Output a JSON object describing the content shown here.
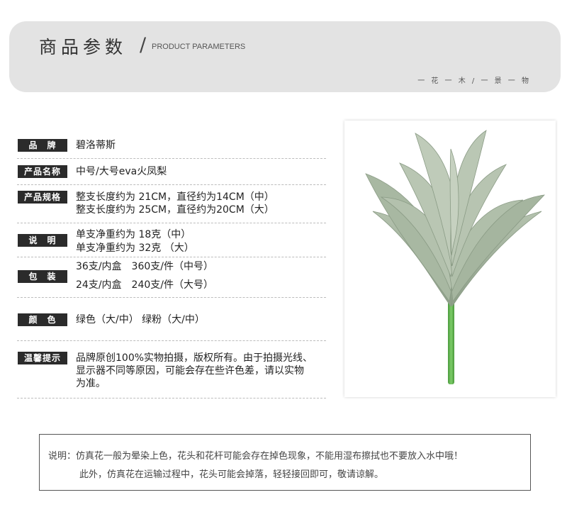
{
  "header": {
    "title": "商品参数",
    "slash": "/",
    "subtitle": "PRODUCT PARAMETERS",
    "tagline": "一 花 一 木 / 一 景 一 物"
  },
  "params": [
    {
      "label": "品　牌",
      "lines": [
        "碧洛蒂斯"
      ]
    },
    {
      "label": "产品名称",
      "lines": [
        "中号/大号eva火凤梨"
      ]
    },
    {
      "label": "产品规格",
      "lines": [
        "整支长度约为 21CM，直径约为14CM（中）",
        "整支长度约为 25CM，直径约为20CM（大）"
      ]
    },
    {
      "label": "说　明",
      "lines": [
        "单支净重约为 18克（中）",
        "单支净重约为 32克 （大）"
      ]
    },
    {
      "label": "包　装",
      "lines": [
        "36支/内盒　360支/件（中号）",
        "24支/内盒　240支/件（大号）"
      ]
    },
    {
      "label": "颜　色",
      "lines": [
        "绿色（大/中） 绿粉（大/中）"
      ]
    },
    {
      "label": "温馨提示",
      "lines": [
        "品牌原创100%实物拍摄，版权所有。由于拍摄光线、",
        "显示器不同等原因，可能会存在些许色差，请以实物",
        "为准。"
      ]
    }
  ],
  "note": {
    "line1": "说明：仿真花一般为晕染上色，花头和花杆可能会存在掉色现象，不能用湿布擦拭也不要放入水中哦！",
    "line2": "此外，仿真花在运输过程中，花头可能会掉落，轻轻接回即可，敬请谅解。"
  },
  "photo": {
    "image": "artificial-succulent-bromeliad-photo"
  },
  "colors": {
    "header_bg": "#e3e3e3",
    "label_bg": "#2b2b2b",
    "leaf": "#9fb09a",
    "stem": "#5aa64a"
  }
}
